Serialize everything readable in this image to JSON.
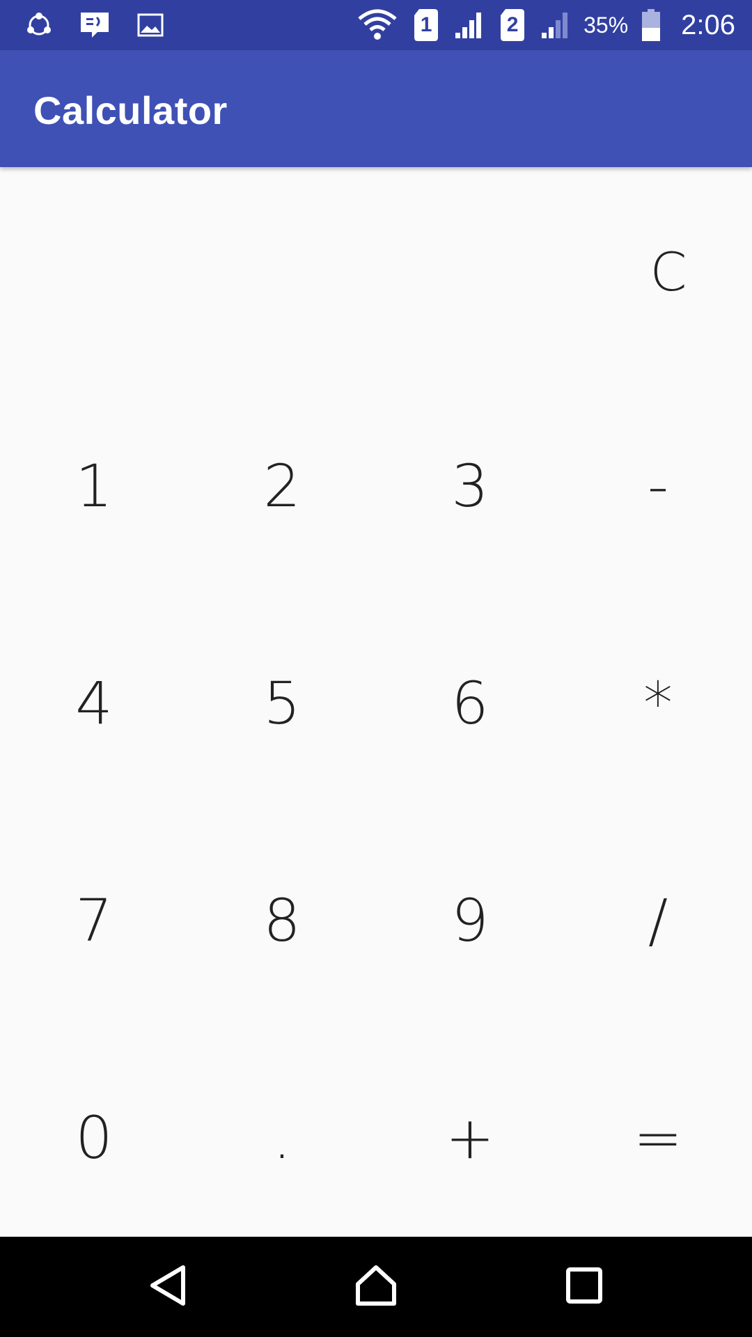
{
  "status_bar": {
    "left_icons": [
      "shareit-icon",
      "message-icon",
      "gallery-icon"
    ],
    "right_icons": [
      "wifi-icon",
      "sim1-icon",
      "signal1-icon",
      "sim2-icon",
      "signal2-icon",
      "battery-icon"
    ],
    "sim1_label": "1",
    "sim2_label": "2",
    "battery_percent": "35%",
    "clock": "2:06"
  },
  "app_bar": {
    "title": "Calculator"
  },
  "calculator": {
    "clear_label": "C",
    "keys": [
      {
        "label": "1",
        "name": "key-1"
      },
      {
        "label": "2",
        "name": "key-2"
      },
      {
        "label": "3",
        "name": "key-3"
      },
      {
        "label": "-",
        "name": "key-minus"
      },
      {
        "label": "4",
        "name": "key-4"
      },
      {
        "label": "5",
        "name": "key-5"
      },
      {
        "label": "6",
        "name": "key-6"
      },
      {
        "label": "*",
        "name": "key-multiply"
      },
      {
        "label": "7",
        "name": "key-7"
      },
      {
        "label": "8",
        "name": "key-8"
      },
      {
        "label": "9",
        "name": "key-9"
      },
      {
        "label": "/",
        "name": "key-divide"
      },
      {
        "label": "0",
        "name": "key-0"
      },
      {
        "label": ".",
        "name": "key-decimal"
      },
      {
        "label": "+",
        "name": "key-plus"
      },
      {
        "label": "=",
        "name": "key-equals"
      }
    ]
  },
  "nav_bar": {
    "buttons": [
      "back-icon",
      "home-icon",
      "recents-icon"
    ]
  },
  "colors": {
    "status_bar": "#3140a0",
    "app_bar": "#3f51b5",
    "background": "#fafafa",
    "nav_bar": "#000000",
    "key_text": "#222222"
  }
}
